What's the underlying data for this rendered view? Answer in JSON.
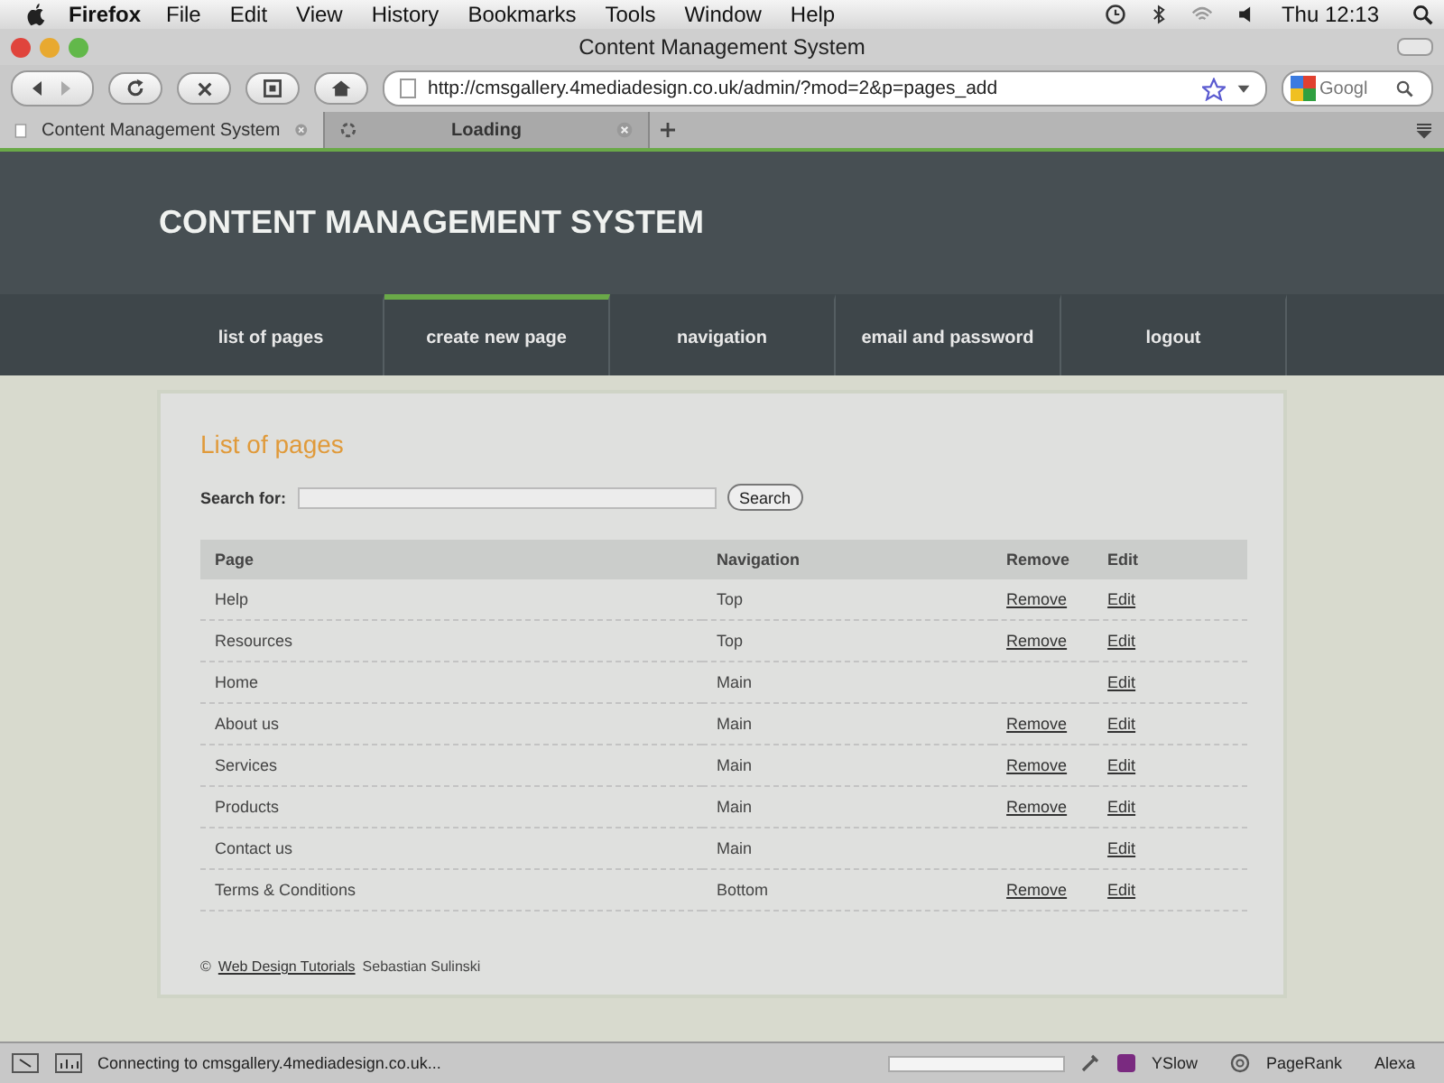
{
  "menubar": {
    "app": "Firefox",
    "menus": [
      "File",
      "Edit",
      "View",
      "History",
      "Bookmarks",
      "Tools",
      "Window",
      "Help"
    ],
    "clock": "Thu 12:13"
  },
  "window": {
    "title": "Content Management System"
  },
  "toolbar": {
    "url": "http://cmsgallery.4mediadesign.co.uk/admin/?mod=2&p=pages_add",
    "search_placeholder": "Googl"
  },
  "tabs": [
    {
      "label": "Content Management System",
      "selected": true
    },
    {
      "label": "Loading",
      "selected": false
    }
  ],
  "site": {
    "title": "CONTENT MANAGEMENT SYSTEM",
    "nav": [
      {
        "label": "list of pages",
        "selected": false
      },
      {
        "label": "create new page",
        "selected": true
      },
      {
        "label": "navigation",
        "selected": false
      },
      {
        "label": "email and password",
        "selected": false
      },
      {
        "label": "logout",
        "selected": false
      }
    ]
  },
  "content": {
    "heading": "List of pages",
    "search_label": "Search for:",
    "search_button": "Search",
    "columns": [
      "Page",
      "Navigation",
      "Remove",
      "Edit"
    ],
    "rows": [
      {
        "page": "Help",
        "navigation": "Top",
        "remove": "Remove",
        "edit": "Edit"
      },
      {
        "page": "Resources",
        "navigation": "Top",
        "remove": "Remove",
        "edit": "Edit"
      },
      {
        "page": "Home",
        "navigation": "Main",
        "edit": "Edit"
      },
      {
        "page": "About us",
        "navigation": "Main",
        "remove": "Remove",
        "edit": "Edit"
      },
      {
        "page": "Services",
        "navigation": "Main",
        "remove": "Remove",
        "edit": "Edit"
      },
      {
        "page": "Products",
        "navigation": "Main",
        "remove": "Remove",
        "edit": "Edit"
      },
      {
        "page": "Contact us",
        "navigation": "Main",
        "edit": "Edit"
      },
      {
        "page": "Terms & Conditions",
        "navigation": "Bottom",
        "remove": "Remove",
        "edit": "Edit"
      }
    ],
    "footer_symbol": "©",
    "footer_link": "Web Design Tutorials",
    "footer_author": "Sebastian Sulinski"
  },
  "status_bar": {
    "text": "Connecting to cmsgallery.4mediadesign.co.uk...",
    "level": 0,
    "items": [
      "YSlow",
      "PageRank",
      "Alexa"
    ]
  }
}
